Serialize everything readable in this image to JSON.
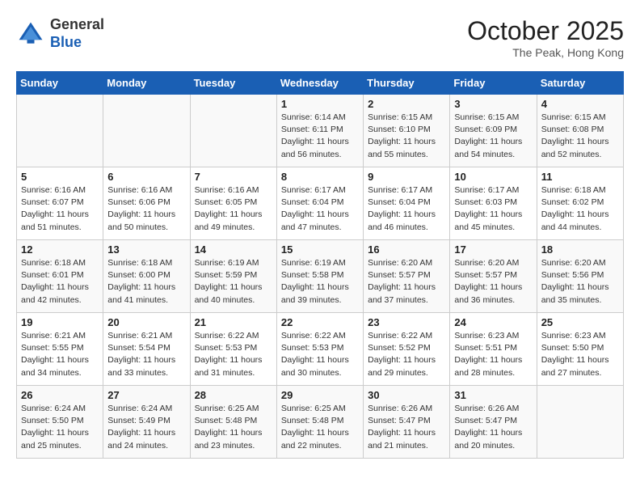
{
  "header": {
    "logo_line1": "General",
    "logo_line2": "Blue",
    "month": "October 2025",
    "location": "The Peak, Hong Kong"
  },
  "days_of_week": [
    "Sunday",
    "Monday",
    "Tuesday",
    "Wednesday",
    "Thursday",
    "Friday",
    "Saturday"
  ],
  "weeks": [
    [
      {
        "day": "",
        "info": ""
      },
      {
        "day": "",
        "info": ""
      },
      {
        "day": "",
        "info": ""
      },
      {
        "day": "1",
        "info": "Sunrise: 6:14 AM\nSunset: 6:11 PM\nDaylight: 11 hours\nand 56 minutes."
      },
      {
        "day": "2",
        "info": "Sunrise: 6:15 AM\nSunset: 6:10 PM\nDaylight: 11 hours\nand 55 minutes."
      },
      {
        "day": "3",
        "info": "Sunrise: 6:15 AM\nSunset: 6:09 PM\nDaylight: 11 hours\nand 54 minutes."
      },
      {
        "day": "4",
        "info": "Sunrise: 6:15 AM\nSunset: 6:08 PM\nDaylight: 11 hours\nand 52 minutes."
      }
    ],
    [
      {
        "day": "5",
        "info": "Sunrise: 6:16 AM\nSunset: 6:07 PM\nDaylight: 11 hours\nand 51 minutes."
      },
      {
        "day": "6",
        "info": "Sunrise: 6:16 AM\nSunset: 6:06 PM\nDaylight: 11 hours\nand 50 minutes."
      },
      {
        "day": "7",
        "info": "Sunrise: 6:16 AM\nSunset: 6:05 PM\nDaylight: 11 hours\nand 49 minutes."
      },
      {
        "day": "8",
        "info": "Sunrise: 6:17 AM\nSunset: 6:04 PM\nDaylight: 11 hours\nand 47 minutes."
      },
      {
        "day": "9",
        "info": "Sunrise: 6:17 AM\nSunset: 6:04 PM\nDaylight: 11 hours\nand 46 minutes."
      },
      {
        "day": "10",
        "info": "Sunrise: 6:17 AM\nSunset: 6:03 PM\nDaylight: 11 hours\nand 45 minutes."
      },
      {
        "day": "11",
        "info": "Sunrise: 6:18 AM\nSunset: 6:02 PM\nDaylight: 11 hours\nand 44 minutes."
      }
    ],
    [
      {
        "day": "12",
        "info": "Sunrise: 6:18 AM\nSunset: 6:01 PM\nDaylight: 11 hours\nand 42 minutes."
      },
      {
        "day": "13",
        "info": "Sunrise: 6:18 AM\nSunset: 6:00 PM\nDaylight: 11 hours\nand 41 minutes."
      },
      {
        "day": "14",
        "info": "Sunrise: 6:19 AM\nSunset: 5:59 PM\nDaylight: 11 hours\nand 40 minutes."
      },
      {
        "day": "15",
        "info": "Sunrise: 6:19 AM\nSunset: 5:58 PM\nDaylight: 11 hours\nand 39 minutes."
      },
      {
        "day": "16",
        "info": "Sunrise: 6:20 AM\nSunset: 5:57 PM\nDaylight: 11 hours\nand 37 minutes."
      },
      {
        "day": "17",
        "info": "Sunrise: 6:20 AM\nSunset: 5:57 PM\nDaylight: 11 hours\nand 36 minutes."
      },
      {
        "day": "18",
        "info": "Sunrise: 6:20 AM\nSunset: 5:56 PM\nDaylight: 11 hours\nand 35 minutes."
      }
    ],
    [
      {
        "day": "19",
        "info": "Sunrise: 6:21 AM\nSunset: 5:55 PM\nDaylight: 11 hours\nand 34 minutes."
      },
      {
        "day": "20",
        "info": "Sunrise: 6:21 AM\nSunset: 5:54 PM\nDaylight: 11 hours\nand 33 minutes."
      },
      {
        "day": "21",
        "info": "Sunrise: 6:22 AM\nSunset: 5:53 PM\nDaylight: 11 hours\nand 31 minutes."
      },
      {
        "day": "22",
        "info": "Sunrise: 6:22 AM\nSunset: 5:53 PM\nDaylight: 11 hours\nand 30 minutes."
      },
      {
        "day": "23",
        "info": "Sunrise: 6:22 AM\nSunset: 5:52 PM\nDaylight: 11 hours\nand 29 minutes."
      },
      {
        "day": "24",
        "info": "Sunrise: 6:23 AM\nSunset: 5:51 PM\nDaylight: 11 hours\nand 28 minutes."
      },
      {
        "day": "25",
        "info": "Sunrise: 6:23 AM\nSunset: 5:50 PM\nDaylight: 11 hours\nand 27 minutes."
      }
    ],
    [
      {
        "day": "26",
        "info": "Sunrise: 6:24 AM\nSunset: 5:50 PM\nDaylight: 11 hours\nand 25 minutes."
      },
      {
        "day": "27",
        "info": "Sunrise: 6:24 AM\nSunset: 5:49 PM\nDaylight: 11 hours\nand 24 minutes."
      },
      {
        "day": "28",
        "info": "Sunrise: 6:25 AM\nSunset: 5:48 PM\nDaylight: 11 hours\nand 23 minutes."
      },
      {
        "day": "29",
        "info": "Sunrise: 6:25 AM\nSunset: 5:48 PM\nDaylight: 11 hours\nand 22 minutes."
      },
      {
        "day": "30",
        "info": "Sunrise: 6:26 AM\nSunset: 5:47 PM\nDaylight: 11 hours\nand 21 minutes."
      },
      {
        "day": "31",
        "info": "Sunrise: 6:26 AM\nSunset: 5:47 PM\nDaylight: 11 hours\nand 20 minutes."
      },
      {
        "day": "",
        "info": ""
      }
    ]
  ]
}
